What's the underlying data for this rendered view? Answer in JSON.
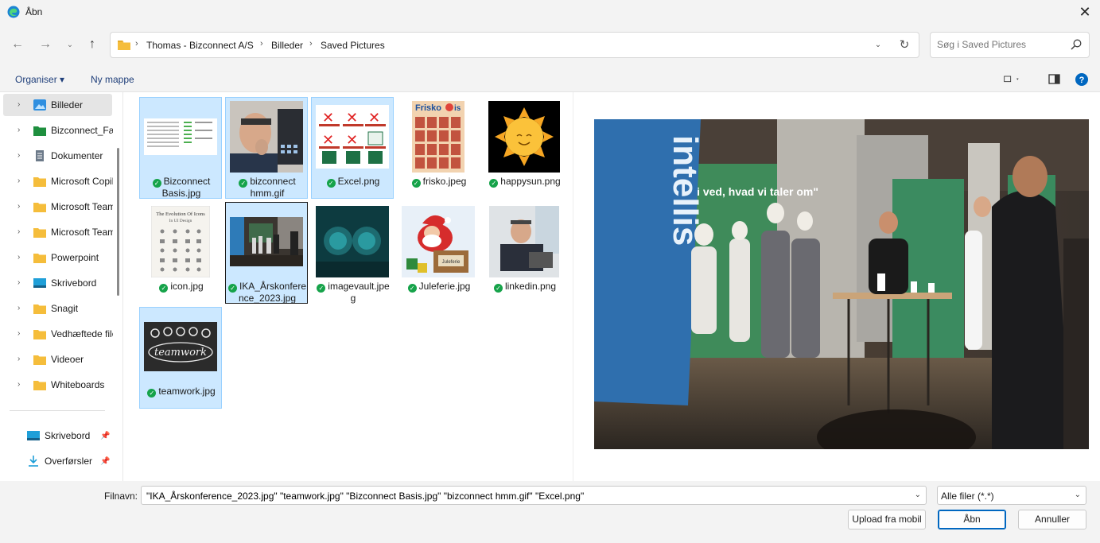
{
  "window": {
    "title": "Åbn",
    "close": "✕"
  },
  "address": {
    "crumbs": [
      "Thomas - Bizconnect A/S",
      "Billeder",
      "Saved Pictures"
    ],
    "separator": "›"
  },
  "search": {
    "placeholder": "Søg i Saved Pictures"
  },
  "commands": {
    "organize": "Organiser ▾",
    "new_folder": "Ny mappe"
  },
  "sidebar": {
    "items": [
      {
        "label": "Billeder",
        "icon": "pictures-icon"
      },
      {
        "label": "Bizconnect_Fælles",
        "icon": "green-folder-icon"
      },
      {
        "label": "Dokumenter",
        "icon": "documents-icon"
      },
      {
        "label": "Microsoft Copilot",
        "icon": "folder-icon"
      },
      {
        "label": "Microsoft Teams",
        "icon": "folder-icon"
      },
      {
        "label": "Microsoft Teams",
        "icon": "folder-icon"
      },
      {
        "label": "Powerpoint",
        "icon": "folder-icon"
      },
      {
        "label": "Skrivebord",
        "icon": "desktop-icon"
      },
      {
        "label": "Snagit",
        "icon": "folder-icon"
      },
      {
        "label": "Vedhæftede filer",
        "icon": "folder-icon"
      },
      {
        "label": "Videoer",
        "icon": "folder-icon"
      },
      {
        "label": "Whiteboards",
        "icon": "folder-icon"
      }
    ],
    "quick": [
      {
        "label": "Skrivebord",
        "icon": "desktop-icon"
      },
      {
        "label": "Overførsler",
        "icon": "download-icon"
      }
    ]
  },
  "files": [
    {
      "line1": "Bizconnect",
      "line2": "Basis.jpg",
      "selected": true
    },
    {
      "line1": "bizconnect",
      "line2": "hmm.gif",
      "selected": true
    },
    {
      "line1": "Excel.png",
      "line2": "",
      "selected": true
    },
    {
      "line1": "frisko.jpeg",
      "line2": "",
      "selected": false
    },
    {
      "line1": "happysun.png",
      "line2": "",
      "selected": false
    },
    {
      "line1": "icon.jpg",
      "line2": "",
      "selected": false
    },
    {
      "line1": "IKA_Årskonfere",
      "line2": "nce_2023.jpg",
      "selected": true
    },
    {
      "line1": "imagevault.jpe",
      "line2": "g",
      "selected": false
    },
    {
      "line1": "Juleferie.jpg",
      "line2": "",
      "selected": false
    },
    {
      "line1": "linkedin.png",
      "line2": "",
      "selected": false
    },
    {
      "line1": "teamwork.jpg",
      "line2": "",
      "selected": true
    }
  ],
  "thumb_text": {
    "frisko": "Frisko",
    "frisko_is": "is",
    "icon_title": "The Evolution Of Icons",
    "icon_sub": "In UI Design",
    "juleferie_sign": "Juleferie",
    "teamwork": "teamwork"
  },
  "preview_text": {
    "banner": "intellis",
    "slogan": "Vi ved, hvad vi taler om\""
  },
  "bottom": {
    "filename_label": "Filnavn:",
    "filename_value": "\"IKA_Årskonference_2023.jpg\" \"teamwork.jpg\" \"Bizconnect Basis.jpg\" \"bizconnect hmm.gif\" \"Excel.png\"",
    "filter": "Alle filer (*.*)",
    "upload": "Upload fra mobil",
    "open": "Åbn",
    "cancel": "Annuller"
  },
  "colors": {
    "accent": "#0067c0",
    "selection": "#cce8ff",
    "check": "#16a34a"
  }
}
